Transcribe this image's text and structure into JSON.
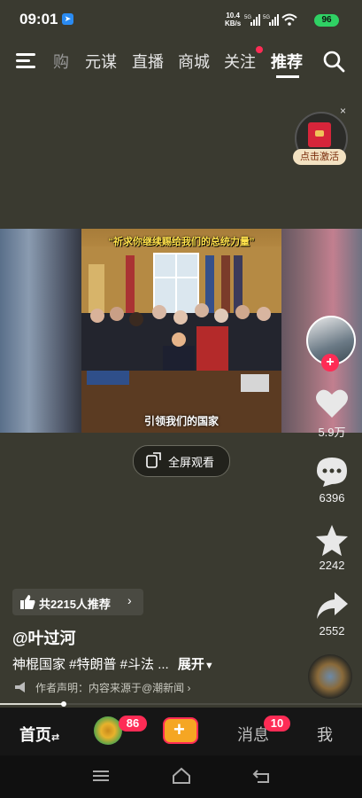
{
  "status_bar": {
    "time": "09:01",
    "net_speed_value": "10.4",
    "net_speed_unit": "KB/s",
    "signal1": "5G",
    "signal2": "5G",
    "battery": "96"
  },
  "top_nav": {
    "tabs": [
      "购",
      "元谋",
      "直播",
      "商城",
      "关注",
      "推荐"
    ],
    "active_tab": "推荐"
  },
  "red_packet": {
    "label": "点击激活",
    "close": "×"
  },
  "video": {
    "caption_top": "“祈求你继续赐给我们的总统力量”",
    "caption_bottom": "引领我们的国家"
  },
  "fullscreen": {
    "label": "全屏观看"
  },
  "actions": {
    "likes": "5.9万",
    "comments": "6396",
    "favorites": "2242",
    "shares": "2552"
  },
  "recommend": {
    "label": "共2215人推荐"
  },
  "post": {
    "author": "@叶过河",
    "description": "神棍国家 #特朗普 #斗法 ...",
    "expand": "展开",
    "notice": "作者声明：内容来源于@潮新闻"
  },
  "bottom_nav": {
    "home": "首页",
    "friends_badge": "86",
    "messages": "消息",
    "messages_badge": "10",
    "me": "我"
  },
  "colors": {
    "accent": "#fe2c55",
    "battery": "#2fd164",
    "add_button": "#f5a623"
  }
}
